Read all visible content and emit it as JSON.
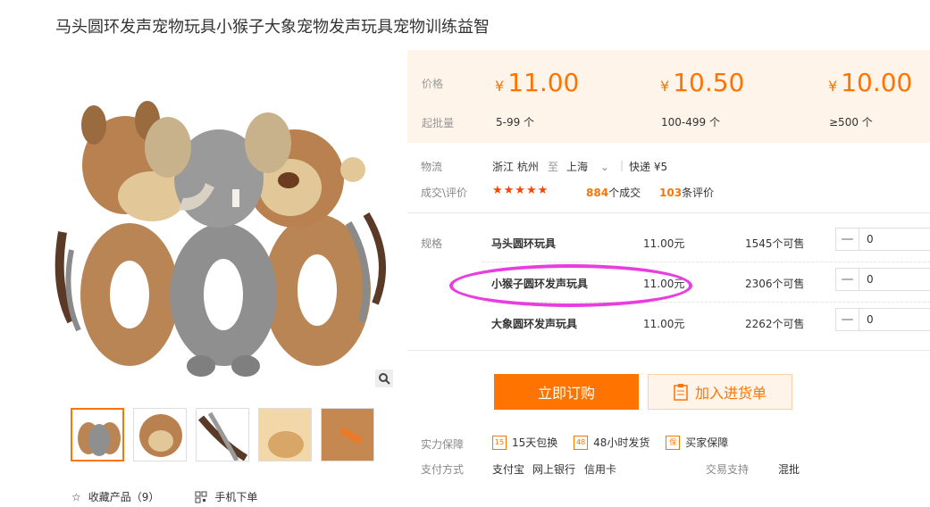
{
  "title": "马头圆环发声宠物玩具小猴子大象宠物发声玩具宠物训练益智",
  "price_panel": {
    "price_label": "价格",
    "moq_label": "起批量",
    "currency": "¥",
    "tiers": [
      {
        "price": "11.00",
        "range": "5-99 个"
      },
      {
        "price": "10.50",
        "range": "100-499 个"
      },
      {
        "price": "10.00",
        "range": "≥500 个"
      }
    ]
  },
  "logistics": {
    "label": "物流",
    "from": "浙江 杭州",
    "to_word": "至",
    "to": "上海",
    "express": "快递 ¥5"
  },
  "deals": {
    "label": "成交\\评价",
    "stars": "★★★★★",
    "deals_count": "884",
    "deals_suffix": "个成交",
    "reviews_count": "103",
    "reviews_suffix": "条评价"
  },
  "spec": {
    "label": "规格",
    "rows": [
      {
        "name": "马头圆环玩具",
        "price": "11.00元",
        "stock": "1545个可售",
        "qty": "0"
      },
      {
        "name": "小猴子圆环发声玩具",
        "price": "11.00元",
        "stock": "2306个可售",
        "qty": "0"
      },
      {
        "name": "大象圆环发声玩具",
        "price": "11.00元",
        "stock": "2262个可售",
        "qty": "0"
      }
    ]
  },
  "buttons": {
    "buy": "立即订购",
    "cart": "加入进货单"
  },
  "guarantee": {
    "label": "实力保障",
    "items": [
      {
        "icon": "15",
        "text": "15天包换"
      },
      {
        "icon": "48",
        "text": "48小时发货"
      },
      {
        "icon": "保",
        "text": "买家保障"
      }
    ]
  },
  "payment": {
    "label": "支付方式",
    "methods": [
      "支付宝",
      "网上银行",
      "信用卡"
    ],
    "trade_label": "交易支持",
    "trade_value": "混批"
  },
  "left_actions": {
    "favorite": "收藏产品（9）",
    "mobile": "手机下单"
  },
  "colors": {
    "accent": "#ff7300",
    "price_bg": "#fff4ea",
    "annotation": "#e83ee0"
  }
}
